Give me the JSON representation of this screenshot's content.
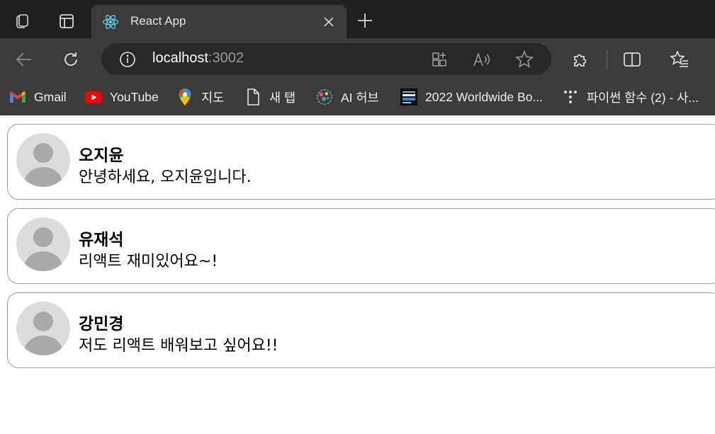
{
  "browser": {
    "tab": {
      "title": "React App"
    },
    "address": {
      "host": "localhost",
      "port": ":3002"
    },
    "bookmarks": [
      {
        "label": "Gmail",
        "icon": "gmail-icon"
      },
      {
        "label": "YouTube",
        "icon": "youtube-icon"
      },
      {
        "label": "지도",
        "icon": "maps-icon"
      },
      {
        "label": "새 탭",
        "icon": "page-icon"
      },
      {
        "label": "AI 허브",
        "icon": "ai-hub-icon"
      },
      {
        "label": "2022 Worldwide Bo...",
        "icon": "box-office-icon"
      },
      {
        "label": "파이썬 함수 (2) - 사...",
        "icon": "python-site-icon"
      }
    ],
    "colors": {
      "tabstrip": "#202020",
      "toolbar": "#3b3b3b",
      "addressbar": "#272727"
    }
  },
  "comments": [
    {
      "name": "오지윤",
      "text": "안녕하세요, 오지윤입니다."
    },
    {
      "name": "유재석",
      "text": "리액트 재미있어요~!"
    },
    {
      "name": "강민경",
      "text": "저도 리액트 배워보고 싶어요!!"
    }
  ]
}
